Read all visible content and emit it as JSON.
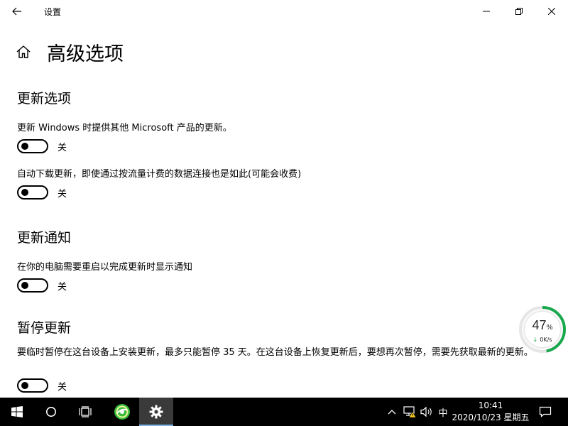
{
  "window": {
    "title": "设置"
  },
  "page": {
    "title": "高级选项"
  },
  "sections": [
    {
      "heading": "更新选项",
      "items": [
        {
          "description": "更新 Windows 时提供其他 Microsoft 产品的更新。",
          "state_label": "关"
        },
        {
          "description": "自动下载更新，即使通过按流量计费的数据连接也是如此(可能会收费)",
          "state_label": "关"
        }
      ]
    },
    {
      "heading": "更新通知",
      "items": [
        {
          "description": "在你的电脑需要重启以完成更新时显示通知",
          "state_label": "关"
        }
      ]
    },
    {
      "heading": "暂停更新",
      "items": [
        {
          "description": "要临时暂停在这台设备上安装更新，最多只能暂停 35 天。在这台设备上恢复更新后，要想再次暂停，需要先获取最新的更新。",
          "state_label": "关"
        }
      ]
    }
  ],
  "net_widget": {
    "percent": "47",
    "percent_unit": "%",
    "speed": "0K/s",
    "ring_fraction": 0.47,
    "ring_color": "#1aa84e"
  },
  "taskbar": {
    "ime": "中",
    "time": "10:41",
    "date": "2020/10/23 星期五"
  },
  "icons": {
    "back": "back-arrow-icon",
    "home": "home-icon",
    "start": "windows-logo-icon",
    "search": "cortana-circle-icon",
    "taskview": "task-view-icon",
    "app": "browser-360-icon",
    "settings": "gear-icon",
    "network": "network-warning-icon",
    "volume": "speaker-icon",
    "notifications": "action-center-icon"
  },
  "colors": {
    "taskbar": "#000000",
    "active_app": "#3a3a3a",
    "accent": "#7cb4e8"
  }
}
